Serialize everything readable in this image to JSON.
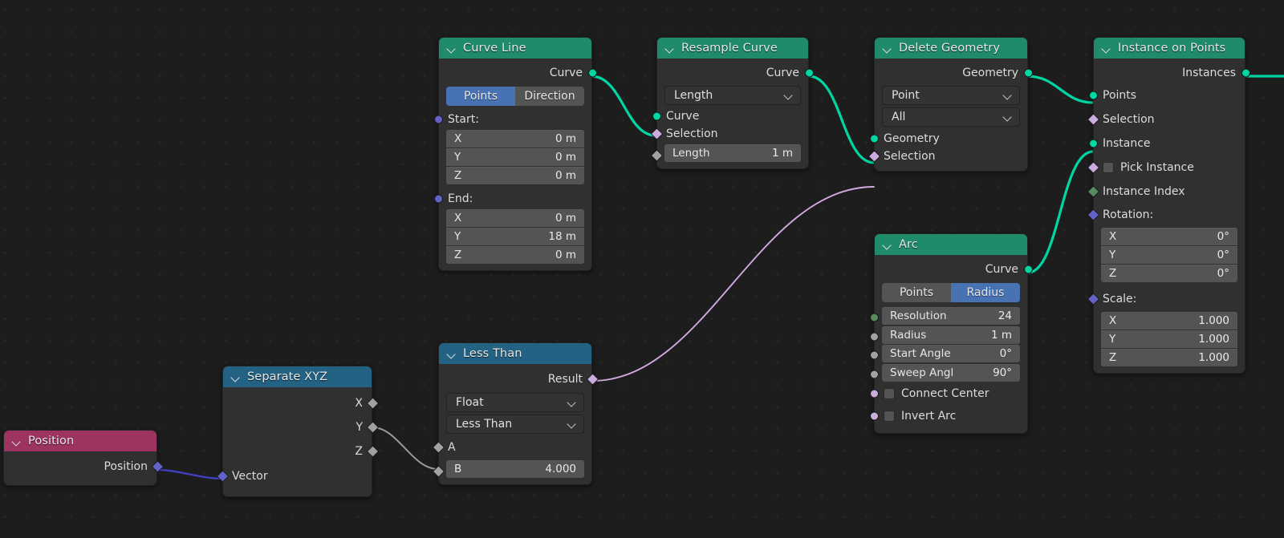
{
  "app": {
    "editor": "blender-geometry-node-editor",
    "background": "#1d1d1d"
  },
  "colors": {
    "geometry_header": "#1f8b6b",
    "converter_header": "#246283",
    "input_header": "#9c3361",
    "socket_geometry": "#00d6a3",
    "socket_boolean": "#ccabe0",
    "socket_vector": "#6363c7",
    "socket_float": "#a1a1a1",
    "socket_integer": "#598c5c",
    "toggle_active": "#4772b3",
    "wire_geometry": "#00d6a3",
    "wire_boolean": "#d2a8e0",
    "wire_float": "#9a9a9a",
    "wire_vector": "#4040c8"
  },
  "nodes": {
    "curve_line": {
      "title": "Curve Line",
      "output_curve": "Curve",
      "toggle": {
        "options": [
          "Points",
          "Direction"
        ],
        "active": "Points"
      },
      "start_label": "Start:",
      "start": [
        {
          "axis": "X",
          "value": "0 m"
        },
        {
          "axis": "Y",
          "value": "0 m"
        },
        {
          "axis": "Z",
          "value": "0 m"
        }
      ],
      "end_label": "End:",
      "end": [
        {
          "axis": "X",
          "value": "0 m"
        },
        {
          "axis": "Y",
          "value": "18 m"
        },
        {
          "axis": "Z",
          "value": "0 m"
        }
      ]
    },
    "resample_curve": {
      "title": "Resample Curve",
      "output_curve": "Curve",
      "mode": "Length",
      "input_curve": "Curve",
      "input_selection": "Selection",
      "length_label": "Length",
      "length_value": "1 m"
    },
    "delete_geometry": {
      "title": "Delete Geometry",
      "output_geometry": "Geometry",
      "domain": "Point",
      "mode": "All",
      "input_geometry": "Geometry",
      "input_selection": "Selection"
    },
    "instance_on_points": {
      "title": "Instance on Points",
      "output_instances": "Instances",
      "input_points": "Points",
      "input_selection": "Selection",
      "input_instance": "Instance",
      "pick_instance": "Pick Instance",
      "instance_index": "Instance Index",
      "rotation_label": "Rotation:",
      "rotation": [
        {
          "axis": "X",
          "value": "0°"
        },
        {
          "axis": "Y",
          "value": "0°"
        },
        {
          "axis": "Z",
          "value": "0°"
        }
      ],
      "scale_label": "Scale:",
      "scale": [
        {
          "axis": "X",
          "value": "1.000"
        },
        {
          "axis": "Y",
          "value": "1.000"
        },
        {
          "axis": "Z",
          "value": "1.000"
        }
      ]
    },
    "arc": {
      "title": "Arc",
      "output_curve": "Curve",
      "toggle": {
        "options": [
          "Points",
          "Radius"
        ],
        "active": "Radius"
      },
      "fields": [
        {
          "label": "Resolution",
          "value": "24"
        },
        {
          "label": "Radius",
          "value": "1 m"
        },
        {
          "label": "Start Angle",
          "value": "0°"
        },
        {
          "label": "Sweep Angl",
          "value": "90°"
        }
      ],
      "connect_center": "Connect Center",
      "invert_arc": "Invert Arc"
    },
    "less_than": {
      "title": "Less Than",
      "output_result": "Result",
      "data_type": "Float",
      "operation": "Less Than",
      "input_a": "A",
      "input_b_label": "B",
      "input_b_value": "4.000"
    },
    "separate_xyz": {
      "title": "Separate XYZ",
      "outputs": [
        "X",
        "Y",
        "Z"
      ],
      "input_vector": "Vector"
    },
    "position": {
      "title": "Position",
      "output_position": "Position"
    }
  }
}
